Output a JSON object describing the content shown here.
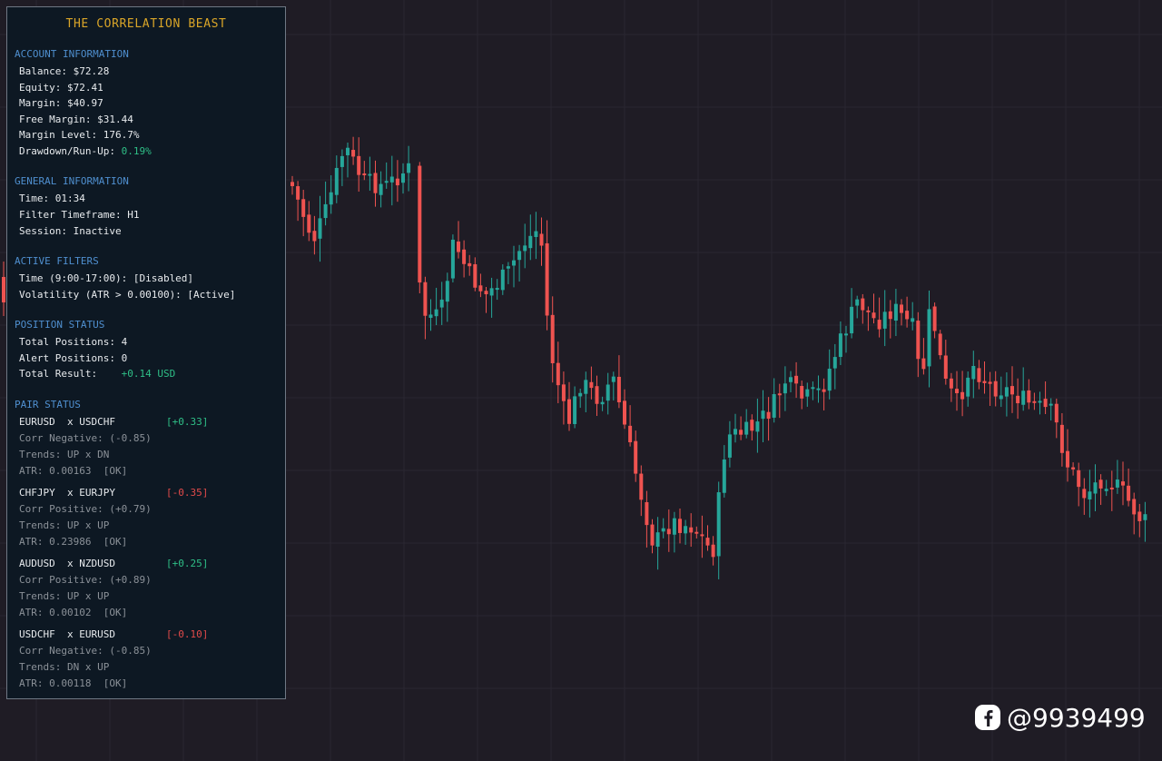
{
  "panel": {
    "title": "THE CORRELATION BEAST",
    "account": {
      "header": "ACCOUNT INFORMATION",
      "balance": "Balance: $72.28",
      "equity": "Equity: $72.41",
      "margin": "Margin: $40.97",
      "free_margin": "Free Margin: $31.44",
      "margin_level": "Margin Level: 176.7%",
      "drawdown_label": "Drawdown/Run-Up:",
      "drawdown_value": "0.19%"
    },
    "general": {
      "header": "GENERAL INFORMATION",
      "time": "Time: 01:34",
      "filter_timeframe": "Filter Timeframe: H1",
      "session": "Session: Inactive"
    },
    "filters": {
      "header": "ACTIVE FILTERS",
      "time_filter": "Time (9:00-17:00): [Disabled]",
      "volatility_filter": "Volatility (ATR > 0.00100): [Active]"
    },
    "position": {
      "header": "POSITION STATUS",
      "total_positions": "Total Positions: 4",
      "alert_positions": "Alert Positions: 0",
      "total_result_label": "Total Result:",
      "total_result_value": "+0.14 USD"
    },
    "pairs": {
      "header": "PAIR STATUS",
      "items": [
        {
          "pair": "EURUSD  x USDCHF",
          "result": "[+0.33]",
          "sign": "pos",
          "corr": "Corr Negative: (-0.85)",
          "trends": "Trends: UP x DN",
          "atr": "ATR: 0.00163  [OK]"
        },
        {
          "pair": "CHFJPY  x EURJPY",
          "result": "[-0.35]",
          "sign": "neg",
          "corr": "Corr Positive: (+0.79)",
          "trends": "Trends: UP x UP",
          "atr": "ATR: 0.23986  [OK]"
        },
        {
          "pair": "AUDUSD  x NZDUSD",
          "result": "[+0.25]",
          "sign": "pos",
          "corr": "Corr Positive: (+0.89)",
          "trends": "Trends: UP x UP",
          "atr": "ATR: 0.00102  [OK]"
        },
        {
          "pair": "USDCHF  x EURUSD",
          "result": "[-0.10]",
          "sign": "neg",
          "corr": "Corr Negative: (-0.85)",
          "trends": "Trends: DN x UP",
          "atr": "ATR: 0.00118  [OK]"
        }
      ]
    }
  },
  "watermark": {
    "handle": "@9939499",
    "icon": "facebook-icon"
  },
  "colors": {
    "background": "#1f1c25",
    "bull": "#26a69a",
    "bear": "#ef5350",
    "title": "#d9a528",
    "section": "#4f8fcf",
    "positive": "#2fbf87",
    "negative": "#e24a4a"
  }
}
